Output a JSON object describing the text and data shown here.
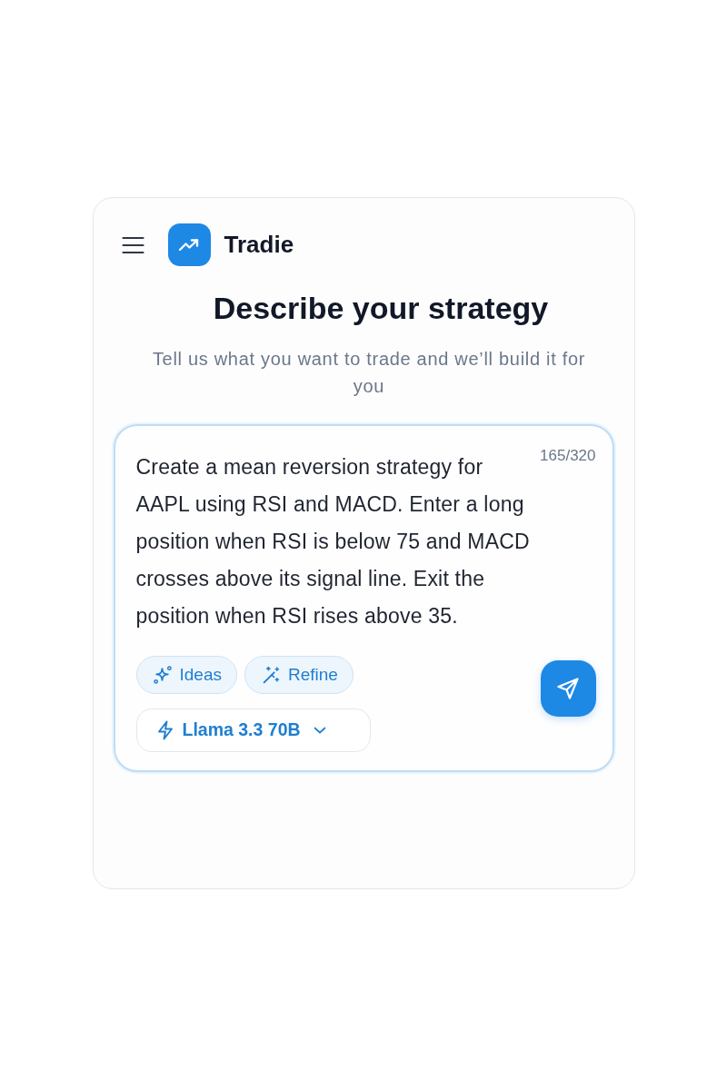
{
  "app": {
    "title": "Tradie"
  },
  "heading": "Describe your strategy",
  "subtitle": "Tell us what you want to trade and we’ll build it for you",
  "prompt": {
    "value": "Create a mean reversion strategy for AAPL using RSI and MACD. Enter a long position when RSI is below 75 and MACD crosses above its signal line. Exit the position when RSI rises above 35.",
    "counter": "165/320"
  },
  "actions": [
    {
      "kind": "ideas",
      "label": "Ideas"
    },
    {
      "kind": "refine",
      "label": "Refine"
    }
  ],
  "model": {
    "label": "Llama 3.3 70B"
  }
}
